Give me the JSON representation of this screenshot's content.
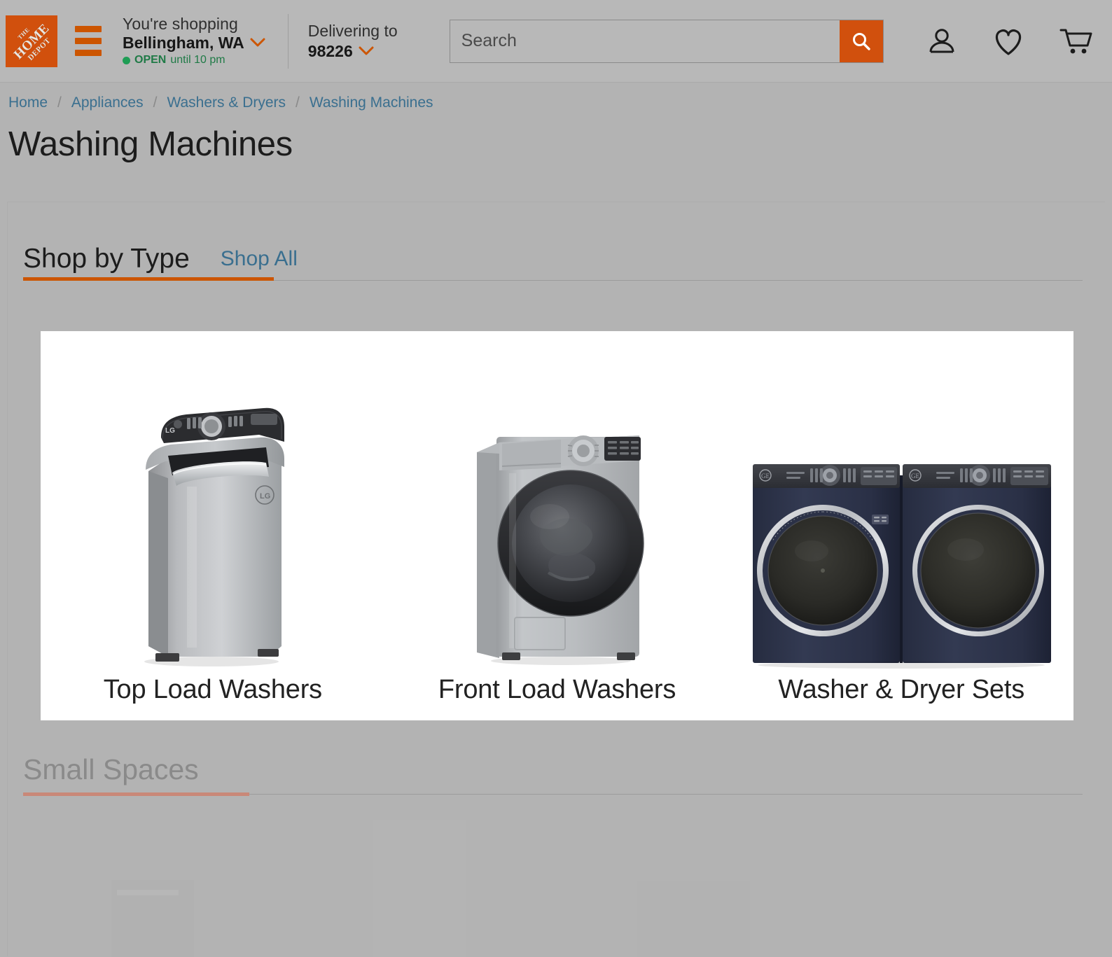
{
  "header": {
    "logo": {
      "line1": "THE",
      "line2": "HOME",
      "line3": "DEPOT",
      "name": "home-depot-logo"
    },
    "menu_label": "Menu",
    "store": {
      "shopping_label": "You're shopping",
      "store_name": "Bellingham, WA",
      "status": "OPEN",
      "hours": "until 10 pm"
    },
    "delivery": {
      "label": "Delivering to",
      "zip": "98226"
    },
    "search": {
      "placeholder": "Search",
      "value": "",
      "button_label": "Search"
    },
    "icons": {
      "account": "account-person-icon",
      "wishlist": "heart-icon",
      "cart": "shopping-cart-icon"
    }
  },
  "breadcrumb": [
    {
      "label": "Home"
    },
    {
      "label": "Appliances"
    },
    {
      "label": "Washers & Dryers"
    },
    {
      "label": "Washing Machines"
    }
  ],
  "breadcrumb_separator": "/",
  "page": {
    "title": "Washing Machines"
  },
  "tabs": [
    {
      "label": "Shop by Type",
      "active": true
    },
    {
      "label": "Shop All",
      "active": false
    }
  ],
  "shop_by_type": {
    "cards": [
      {
        "label": "Top Load Washers",
        "image": "top-load-washer-image"
      },
      {
        "label": "Front Load Washers",
        "image": "front-load-washer-image"
      },
      {
        "label": "Washer & Dryer Sets",
        "image": "washer-dryer-set-image"
      }
    ]
  },
  "sections": [
    {
      "label": "Small Spaces",
      "state": "dimmed"
    }
  ],
  "colors": {
    "brand_orange": "#d1500d",
    "accent_orange": "#cc5500",
    "link_blue": "#3a6f8f",
    "open_green": "#1f7a46",
    "page_bg": "#b3b3b3",
    "header_bg": "#b8b8b8",
    "card_bg": "#ffffff",
    "dimmed_bar": "#c98878"
  }
}
